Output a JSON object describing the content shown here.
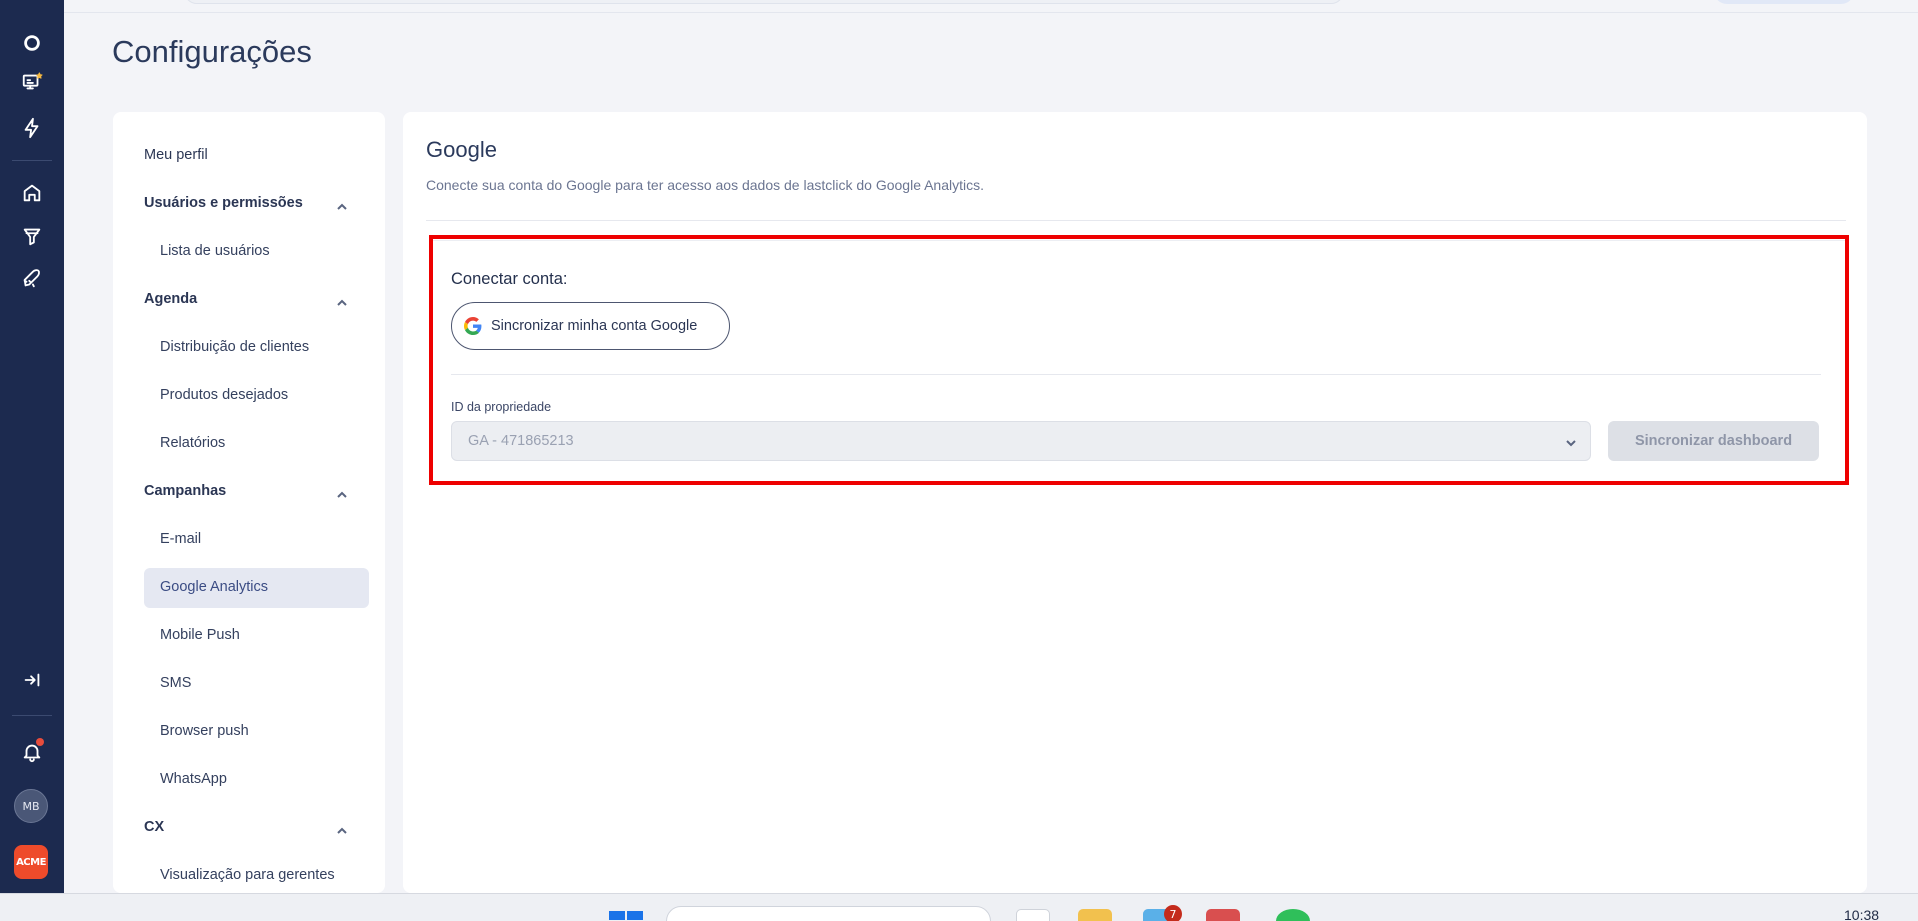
{
  "page": {
    "title": "Configurações"
  },
  "rail": {
    "avatar_initials": "MB",
    "brand_logo_text": "ACME",
    "icons": [
      "logo-ring-icon",
      "presentation-star-icon",
      "lightning-icon",
      "home-icon",
      "funnel-icon",
      "rocket-icon",
      "collapse-sidebar-icon",
      "bell-icon"
    ]
  },
  "menu": {
    "my_profile": "Meu perfil",
    "users_group": "Usuários e permissões",
    "users_list": "Lista de usuários",
    "agenda_group": "Agenda",
    "clients_distribution": "Distribuição de clientes",
    "desired_products": "Produtos desejados",
    "reports": "Relatórios",
    "campaigns_group": "Campanhas",
    "email": "E-mail",
    "google_analytics": "Google Analytics",
    "mobile_push": "Mobile Push",
    "sms": "SMS",
    "browser_push": "Browser push",
    "whatsapp": "WhatsApp",
    "cx_group": "CX",
    "managers_view": "Visualização para gerentes"
  },
  "google": {
    "title": "Google",
    "description": "Conecte sua conta do Google para ter acesso aos dados de lastclick do Google Analytics.",
    "connect_label": "Conectar conta:",
    "sync_account_button": "Sincronizar minha conta Google",
    "property_label": "ID da propriedade",
    "property_value": "GA - 471865213",
    "sync_dashboard_button": "Sincronizar dashboard"
  },
  "colors": {
    "rail_bg": "#1c2a4f",
    "highlight_border": "#ee0000",
    "active_menu_bg": "#e5e8f2",
    "active_menu_text": "#3b4c84"
  },
  "taskbar": {
    "time": "10:38",
    "badge_count": "7"
  }
}
